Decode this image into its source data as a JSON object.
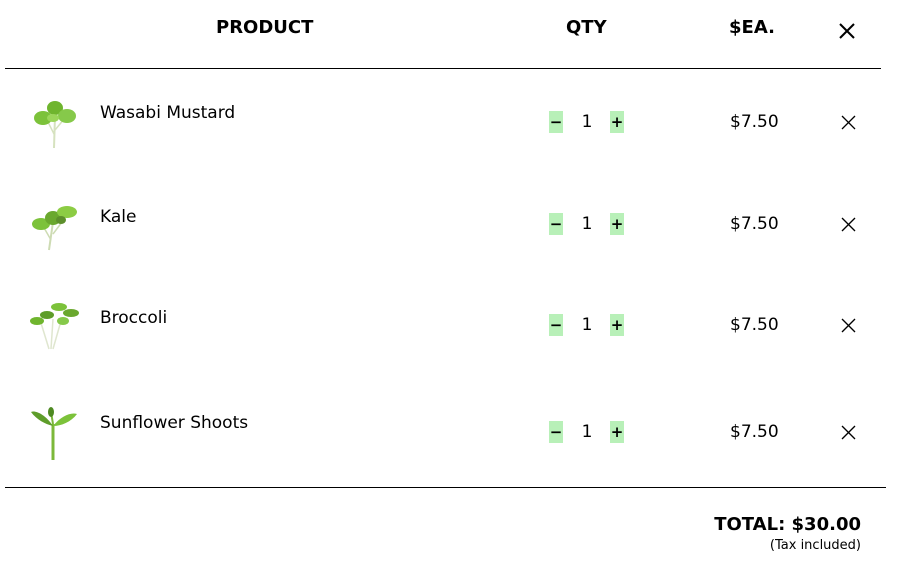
{
  "header": {
    "product_label": "PRODUCT",
    "qty_label": "QTY",
    "price_label": "$EA."
  },
  "items": [
    {
      "name": "Wasabi Mustard",
      "qty": "1",
      "price": "$7.50",
      "image": "wasabi-mustard-microgreen"
    },
    {
      "name": "Kale",
      "qty": "1",
      "price": "$7.50",
      "image": "kale-microgreen"
    },
    {
      "name": "Broccoli",
      "qty": "1",
      "price": "$7.50",
      "image": "broccoli-microgreen"
    },
    {
      "name": "Sunflower Shoots",
      "qty": "1",
      "price": "$7.50",
      "image": "sunflower-shoot"
    }
  ],
  "controls": {
    "minus": "−",
    "plus": "+"
  },
  "footer": {
    "total": "TOTAL: $30.00",
    "tax_note": "(Tax included)"
  },
  "colors": {
    "qty_button_bg": "#b8f0b8",
    "leaf_green": "#7cc23a",
    "stem": "#c9d9a8"
  }
}
